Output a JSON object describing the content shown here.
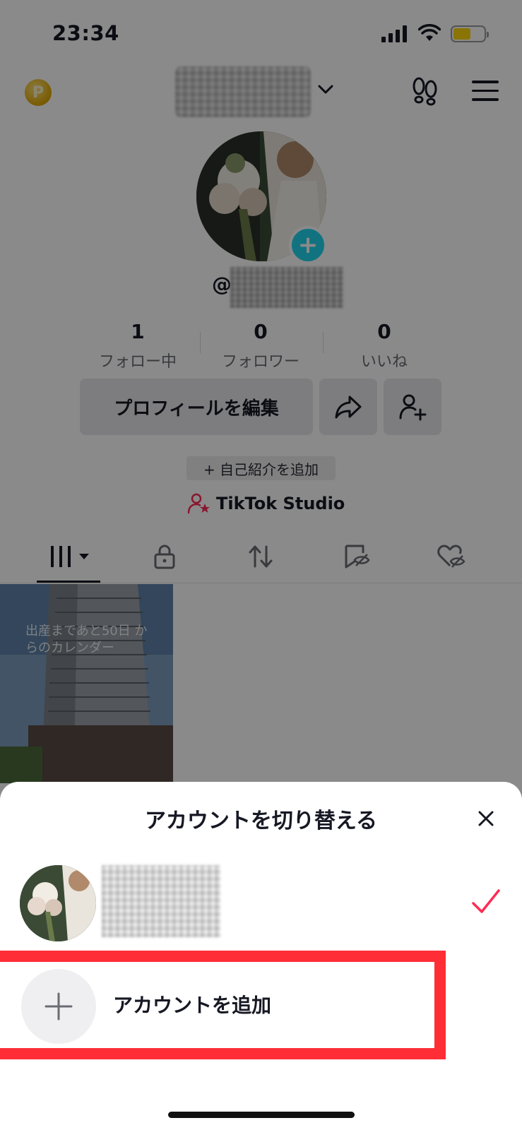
{
  "status_bar": {
    "time": "23:34",
    "battery_color": "#ffd60a"
  },
  "header": {
    "coin_icon": "coin-icon",
    "coin_letter": "P",
    "handle_prefix": "@"
  },
  "stats": [
    {
      "value": "1",
      "label": "フォロー中"
    },
    {
      "value": "0",
      "label": "フォロワー"
    },
    {
      "value": "0",
      "label": "いいね"
    }
  ],
  "actions": {
    "edit_profile": "プロフィールを編集",
    "add_bio": "+ 自己紹介を追加",
    "studio": "TikTok Studio"
  },
  "video_grid": {
    "caption": "出産まであと50日 からのカレンダー"
  },
  "sheet": {
    "title": "アカウントを切り替える",
    "add_account": "アカウントを追加",
    "check_color": "#fe2c55",
    "highlight_color": "#fe2d36"
  },
  "avatar_add_color": "#20d5ec"
}
